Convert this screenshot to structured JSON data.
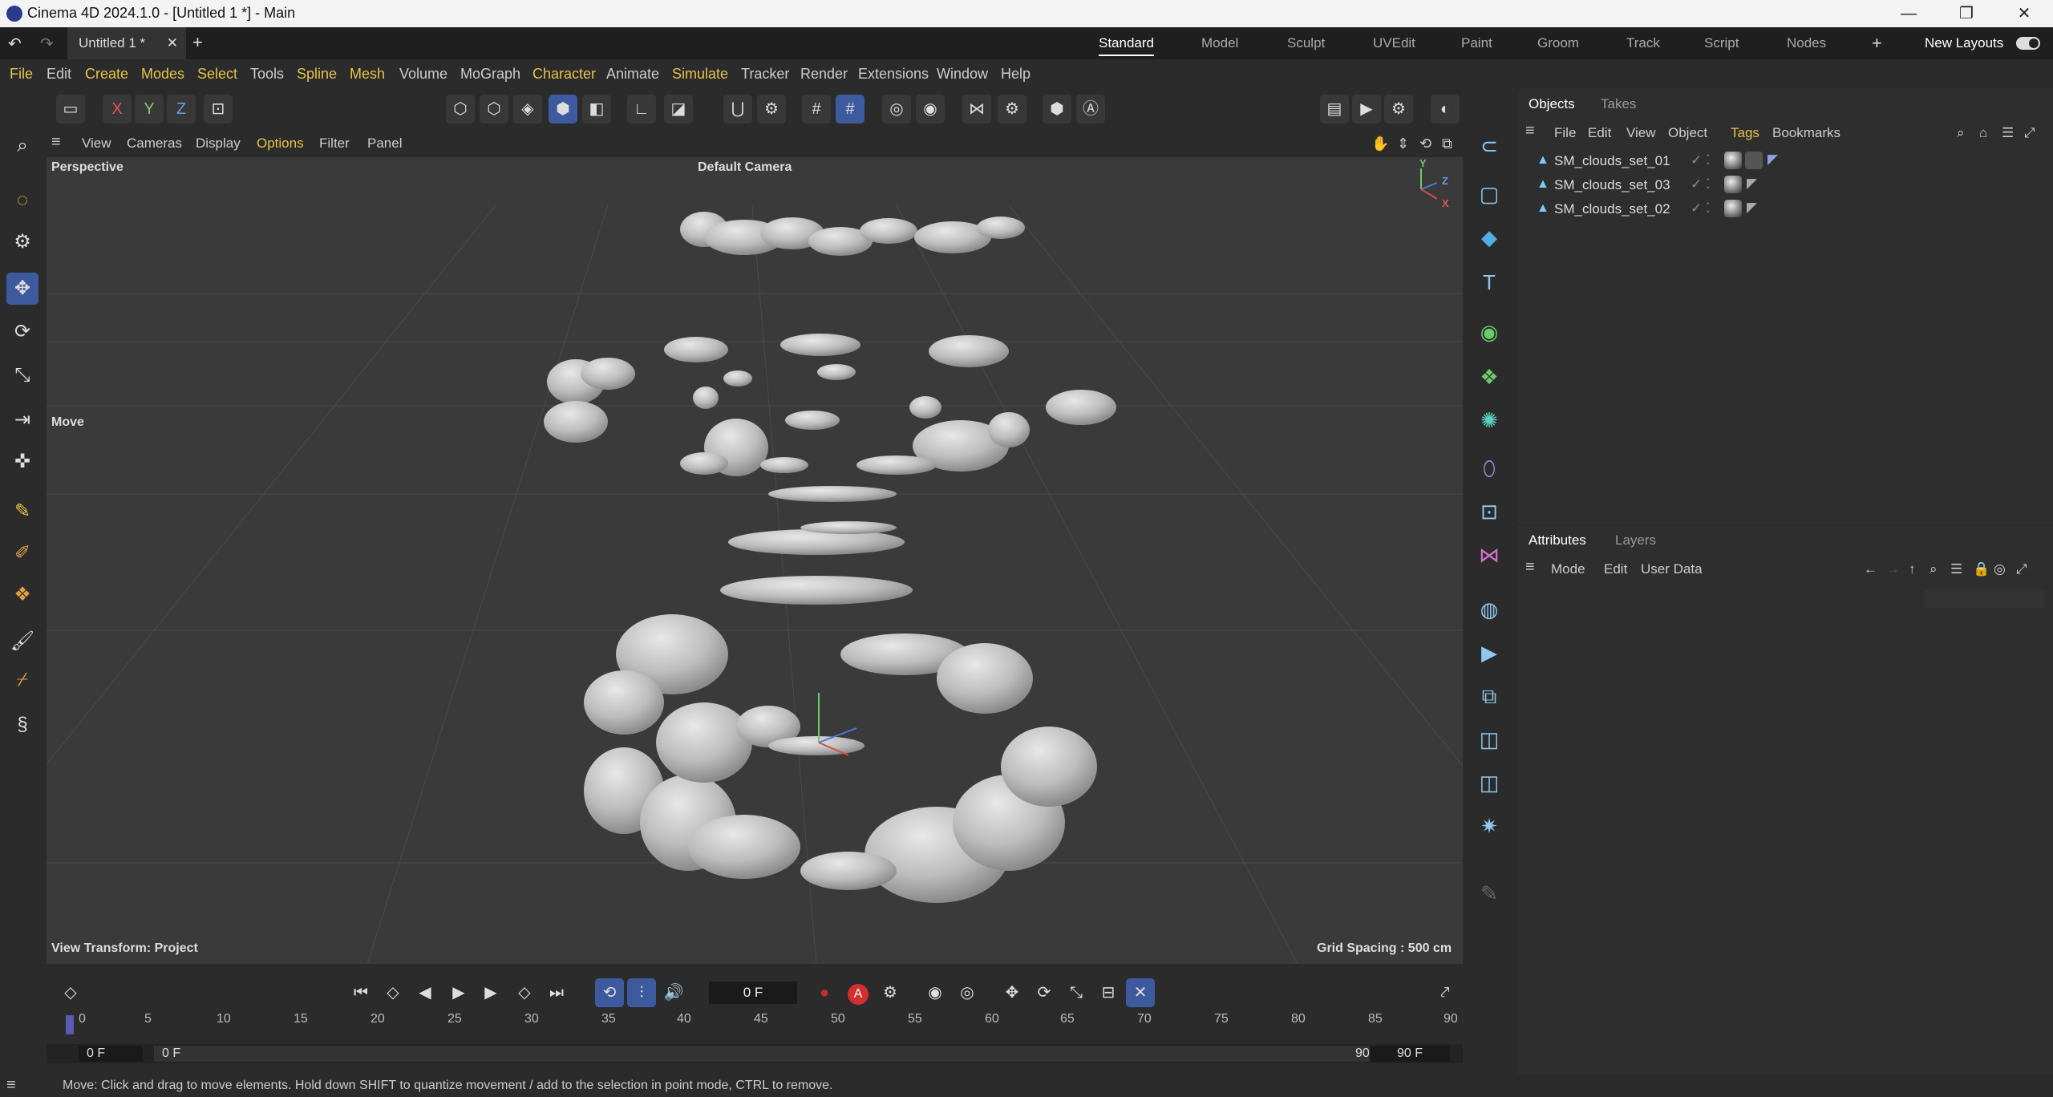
{
  "window": {
    "title": "Cinema 4D 2024.1.0 - [Untitled 1 *] - Main",
    "min": "—",
    "max": "❐",
    "close": "✕"
  },
  "doc_tab": {
    "label": "Untitled 1 *",
    "close": "✕",
    "add": "+"
  },
  "layouts": {
    "items": [
      "Standard",
      "Model",
      "Sculpt",
      "UVEdit",
      "Paint",
      "Groom",
      "Track",
      "Script",
      "Nodes"
    ],
    "add": "+",
    "new_layouts": "New Layouts"
  },
  "menu": [
    "File",
    "Edit",
    "Create",
    "Modes",
    "Select",
    "Tools",
    "Spline",
    "Mesh",
    "Volume",
    "MoGraph",
    "Character",
    "Animate",
    "Simulate",
    "Tracker",
    "Render",
    "Extensions",
    "Window",
    "Help"
  ],
  "toolbar": {
    "x": "X",
    "y": "Y",
    "z": "Z"
  },
  "viewport_menu": [
    "View",
    "Cameras",
    "Display",
    "Options",
    "Filter",
    "Panel"
  ],
  "viewport": {
    "name": "Perspective",
    "camera": "Default Camera",
    "tool": "Move",
    "view_transform": "View Transform: Project",
    "grid_spacing": "Grid Spacing : 500 cm",
    "axis_y": "Y",
    "axis_z": "Z",
    "axis_x": "X"
  },
  "objects_panel": {
    "tabs": [
      "Objects",
      "Takes"
    ],
    "menu": [
      "File",
      "Edit",
      "View",
      "Object",
      "Tags",
      "Bookmarks"
    ],
    "rows": [
      {
        "name": "SM_clouds_set_01"
      },
      {
        "name": "SM_clouds_set_03"
      },
      {
        "name": "SM_clouds_set_02"
      }
    ]
  },
  "attributes_panel": {
    "tabs": [
      "Attributes",
      "Layers"
    ],
    "menu": [
      "Mode",
      "Edit",
      "User Data"
    ]
  },
  "timeline": {
    "current_frame": "0 F",
    "ticks": [
      "0",
      "5",
      "10",
      "15",
      "20",
      "25",
      "30",
      "35",
      "40",
      "45",
      "50",
      "55",
      "60",
      "65",
      "70",
      "75",
      "80",
      "85",
      "90"
    ],
    "start": "0 F",
    "range_start": "0 F",
    "range_end": "90 F",
    "end": "90 F"
  },
  "status": "Move: Click and drag to move elements. Hold down SHIFT to quantize movement / add to the selection in point mode, CTRL to remove.",
  "colors": {
    "accent": "#3d5a9e",
    "highlight_menu": "#e6c34a",
    "viewport_bg": "#3a3a3a",
    "cloud": "#c9c9c9"
  }
}
